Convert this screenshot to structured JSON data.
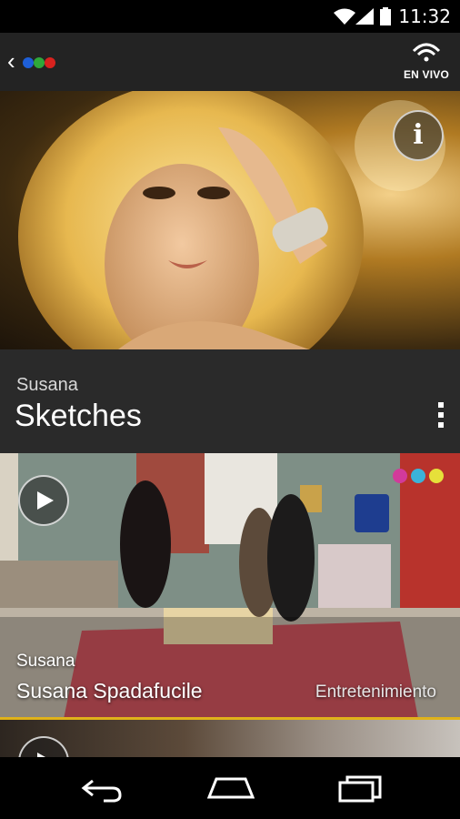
{
  "status_bar": {
    "time": "11:32",
    "icons": [
      "wifi-icon",
      "signal-icon",
      "battery-icon"
    ]
  },
  "app_bar": {
    "logo_dot_colors": [
      "#1e5fd8",
      "#2fa83a",
      "#d8221e"
    ],
    "live_label": "EN VIVO"
  },
  "hero": {
    "info_label": "i"
  },
  "header": {
    "kicker": "Susana",
    "title": "Sketches"
  },
  "video_card": {
    "kicker": "Susana",
    "title": "Susana Spadafucile",
    "category": "Entretenimiento"
  },
  "colors": {
    "accent": "#e0b21a",
    "background": "#1b1b1b",
    "header_bg": "#2a2a2a"
  },
  "nav_bar": {
    "buttons": [
      "back-icon",
      "home-icon",
      "recents-icon"
    ]
  }
}
